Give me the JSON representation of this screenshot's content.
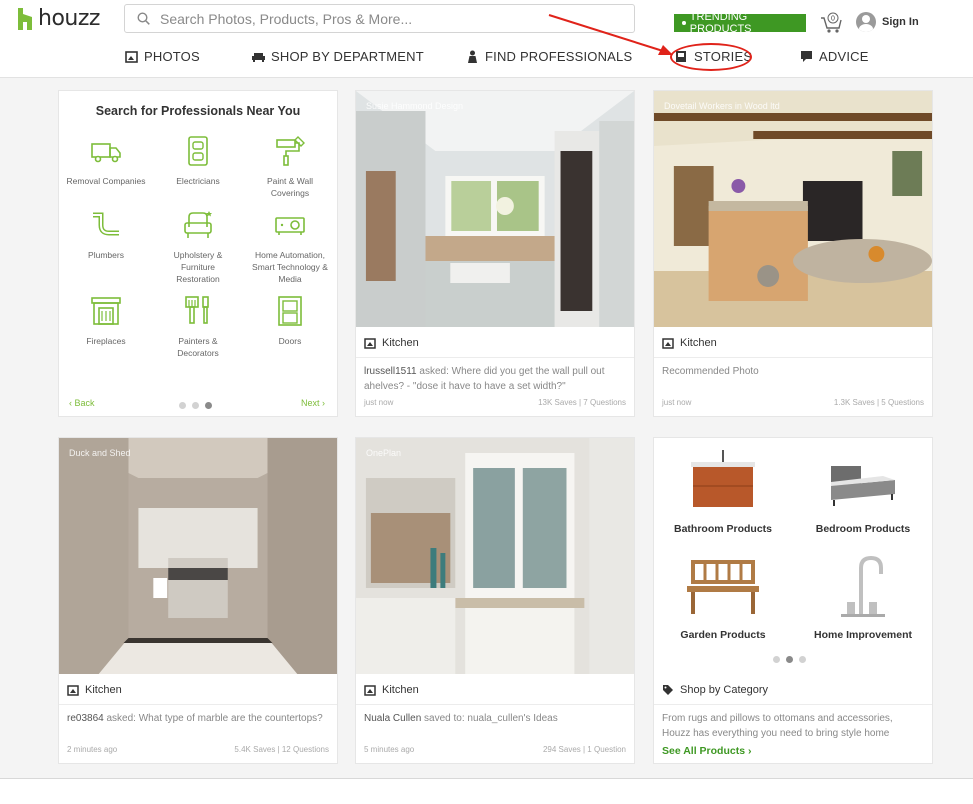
{
  "header": {
    "logo_text": "houzz",
    "search_placeholder": "Search Photos, Products, Pros & More...",
    "trending_label": "TRENDING PRODUCTS",
    "cart_count": "0",
    "signin_label": "Sign In"
  },
  "nav": {
    "photos": "PHOTOS",
    "shop": "SHOP BY DEPARTMENT",
    "find": "FIND PROFESSIONALS",
    "stories": "STORIES",
    "advice": "ADVICE"
  },
  "colors": {
    "brand_green": "#3e9823",
    "accent_green": "#7dbd3a",
    "annotation_red": "#e0231a"
  },
  "pros_card": {
    "title": "Search for Professionals Near You",
    "items": [
      {
        "label_1": "Removal Companies",
        "label_2": "",
        "label_3": "",
        "icon": "truck-icon"
      },
      {
        "label_1": "Electricians",
        "label_2": "",
        "label_3": "",
        "icon": "outlet-icon"
      },
      {
        "label_1": "Paint & Wall",
        "label_2": "Coverings",
        "label_3": "",
        "icon": "paint-roller-icon"
      },
      {
        "label_1": "Plumbers",
        "label_2": "",
        "label_3": "",
        "icon": "pipe-icon"
      },
      {
        "label_1": "Upholstery &",
        "label_2": "Furniture",
        "label_3": "Restoration",
        "icon": "armchair-icon"
      },
      {
        "label_1": "Home Automation,",
        "label_2": "Smart Technology &",
        "label_3": "Media",
        "icon": "projector-icon"
      },
      {
        "label_1": "Fireplaces",
        "label_2": "",
        "label_3": "",
        "icon": "fireplace-icon"
      },
      {
        "label_1": "Painters &",
        "label_2": "Decorators",
        "label_3": "",
        "icon": "brushes-icon"
      },
      {
        "label_1": "Doors",
        "label_2": "",
        "label_3": "",
        "icon": "door-icon"
      }
    ],
    "back_label": "‹ Back",
    "next_label": "Next ›"
  },
  "cards": [
    {
      "credit": "Susie Hammond Design",
      "category": "Kitchen",
      "user": "lrussell1511",
      "text_1": " asked: Where did you get the wall pull out",
      "text_2": "ahelves? - \"dose it have to have a set width?\"",
      "time": "just now",
      "stats": "13K Saves | 7 Questions"
    },
    {
      "credit": "Dovetail Workers in Wood ltd",
      "category": "Kitchen",
      "user": "",
      "text_1": "Recommended Photo",
      "text_2": "",
      "time": "just now",
      "stats": "1.3K Saves | 5 Questions"
    },
    {
      "credit": "Duck and Shed",
      "category": "Kitchen",
      "user": "re03864",
      "text_1": " asked: What type of marble are the countertops?",
      "text_2": "",
      "time": "2 minutes ago",
      "stats": "5.4K Saves | 12 Questions"
    },
    {
      "credit": "OnePlan",
      "category": "Kitchen",
      "user": "Nuala Cullen",
      "text_1": " saved to: nuala_cullen's Ideas",
      "text_2": "",
      "time": "5 minutes ago",
      "stats": "294 Saves | 1 Question"
    }
  ],
  "shop_card": {
    "items": [
      "Bathroom Products",
      "Bedroom Products",
      "Garden Products",
      "Home Improvement"
    ],
    "category_label": "Shop by Category",
    "desc_1": "From rugs and pillows to ottomans and accessories,",
    "desc_2": "Houzz has everything you need to bring style home",
    "see_all": "See All Products ›"
  }
}
